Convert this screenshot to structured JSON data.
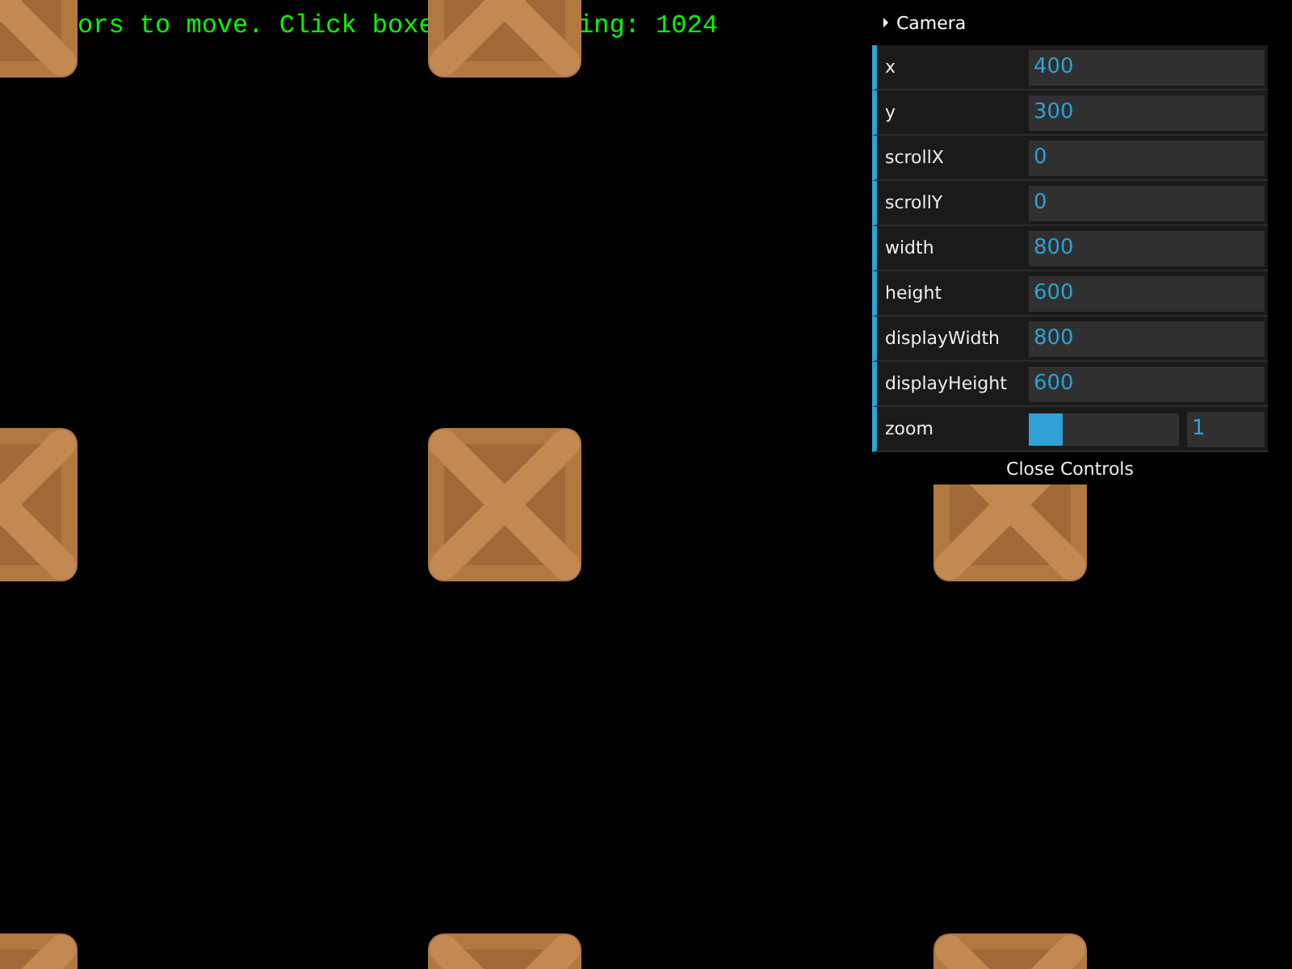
{
  "canvas": {
    "text_fragments": [
      {
        "text": "ors to move. Click boxe"
      },
      {
        "text": "ing: 1024"
      }
    ]
  },
  "gui": {
    "folder_title": "Camera",
    "controllers": [
      {
        "kind": "number",
        "label": "x",
        "value": "400"
      },
      {
        "kind": "number",
        "label": "y",
        "value": "300"
      },
      {
        "kind": "number",
        "label": "scrollX",
        "value": "0"
      },
      {
        "kind": "number",
        "label": "scrollY",
        "value": "0"
      },
      {
        "kind": "number",
        "label": "width",
        "value": "800"
      },
      {
        "kind": "number",
        "label": "height",
        "value": "600"
      },
      {
        "kind": "number",
        "label": "displayWidth",
        "value": "800"
      },
      {
        "kind": "number",
        "label": "displayHeight",
        "value": "600"
      },
      {
        "kind": "slider",
        "label": "zoom",
        "value": "1",
        "level": 0.23
      }
    ],
    "close_button": "Close Controls"
  }
}
